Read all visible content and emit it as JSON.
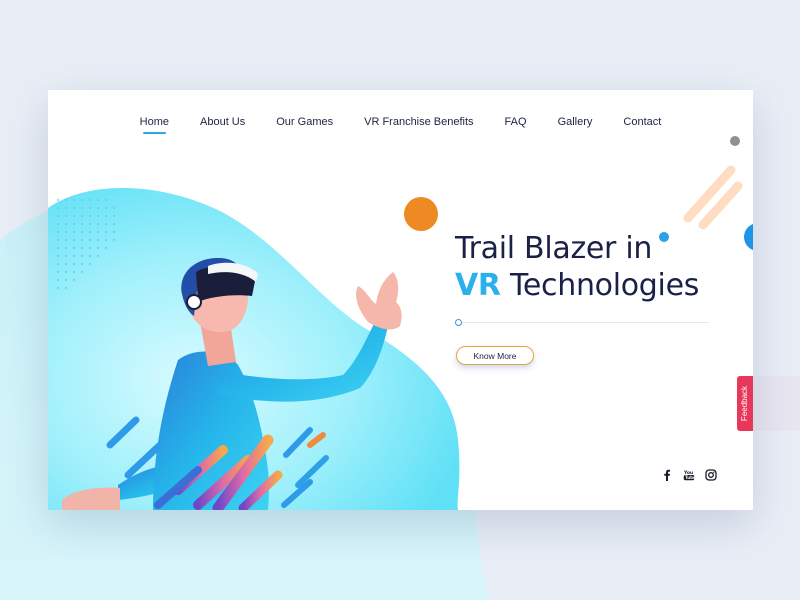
{
  "nav": {
    "items": [
      {
        "label": "Home",
        "active": true
      },
      {
        "label": "About Us"
      },
      {
        "label": "Our Games"
      },
      {
        "label": "VR Franchise Benefits"
      },
      {
        "label": "FAQ"
      },
      {
        "label": "Gallery"
      },
      {
        "label": "Contact"
      }
    ]
  },
  "hero": {
    "title_line1": "Trail Blazer in",
    "title_accent": "VR",
    "title_line2_rest": " Technologies",
    "cta_label": "Know More"
  },
  "social": {
    "icons": [
      "facebook-icon",
      "youtube-icon",
      "instagram-icon"
    ]
  },
  "feedback": {
    "label": "Feedback"
  },
  "colors": {
    "accent": "#2ab0ea",
    "title": "#1a2146",
    "cta_border": "#e8a23a",
    "feedback": "#e8375a",
    "orange_dot": "#ee8a24",
    "blob": "#6fe4f5"
  }
}
